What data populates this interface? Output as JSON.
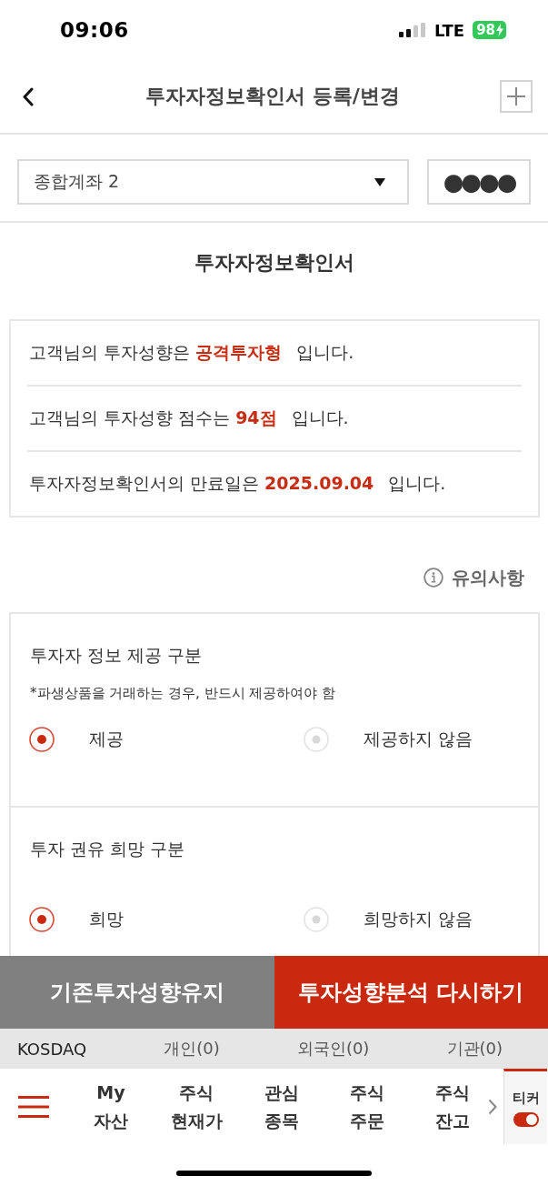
{
  "status_bar": {
    "time": "09:06",
    "network": "LTE",
    "battery": "98"
  },
  "header": {
    "title": "투자자정보확인서 등록/변경"
  },
  "account": {
    "selected_account": "종합계좌 2",
    "password_mask": "●●●●"
  },
  "section_title": "투자자정보확인서",
  "summary": [
    "고객님의 투자성향은 **공격투자형** 입니다.",
    "고객님의 투자성향 점수는 **94점** 입니다.",
    "투자자정보확인서의 만료일은 **2025.09.04** 입니다."
  ],
  "notice": {
    "label": "유의사항"
  },
  "option_groups": [
    {
      "title": "투자자 정보 제공 구분",
      "note": "*파생상품을 거래하는 경우, 반드시 제공하여야 함",
      "options": [
        {
          "label": "제공",
          "selected": true
        },
        {
          "label": "제공하지 않음",
          "selected": false
        }
      ]
    },
    {
      "title": "투자 권유 희망 구분",
      "options": [
        {
          "label": "희망",
          "selected": true
        },
        {
          "label": "희망하지 않음",
          "selected": false
        }
      ]
    }
  ],
  "actions": [
    {
      "label": "기존투자성향유지",
      "kind": "secondary"
    },
    {
      "label": "투자성향분석 다시하기",
      "kind": "primary"
    }
  ],
  "market_bar": {
    "market": "KOSDAQ",
    "investors": [
      "개인(0)",
      "외국인(0)",
      "기관(0)"
    ]
  },
  "bottom_nav": {
    "items": [
      "My 자산",
      "주식 현재가",
      "관심 종목",
      "주식 주문",
      "주식 잔고"
    ],
    "ticker_toggle": {
      "label": "티커",
      "on": true
    }
  }
}
